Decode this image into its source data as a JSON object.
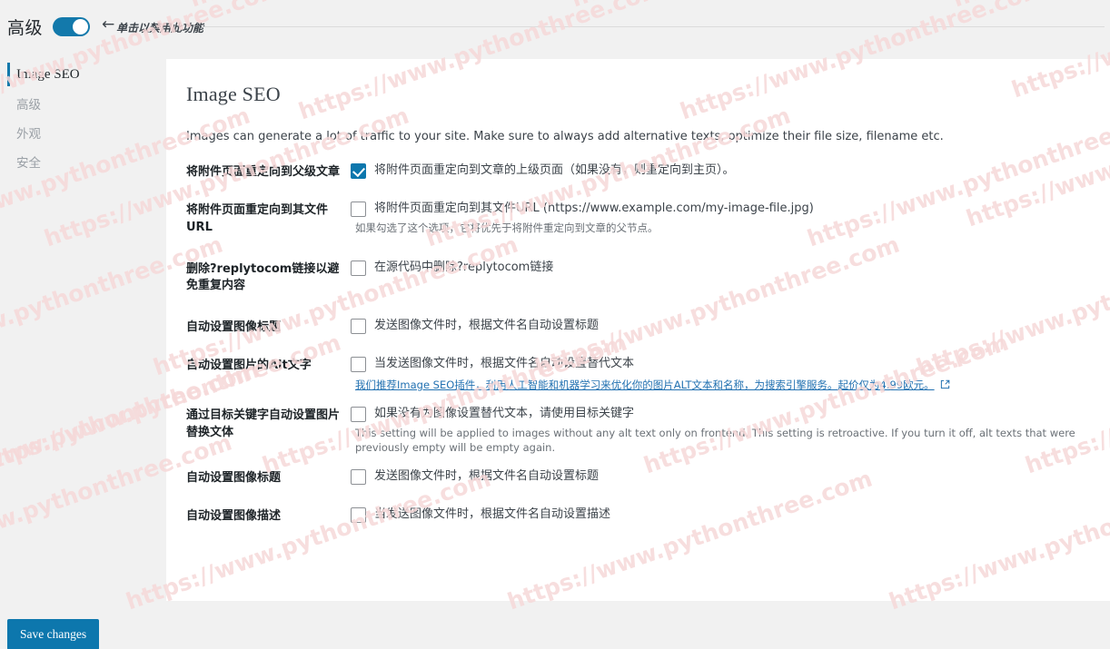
{
  "topbar": {
    "advanced_label": "高级",
    "toggle_on": true,
    "back_arrow_icon": "arrow-left-icon",
    "hint": "单击以禁用此功能"
  },
  "sidebar": {
    "items": [
      {
        "label": "Image SEO",
        "active": true,
        "cjk": false
      },
      {
        "label": "高级",
        "active": false,
        "cjk": true
      },
      {
        "label": "外观",
        "active": false,
        "cjk": true
      },
      {
        "label": "安全",
        "active": false,
        "cjk": true
      }
    ]
  },
  "main": {
    "title": "Image SEO",
    "description": "Images can generate a lot of traffic to your site. Make sure to always add alternative texts, optimize their file size, filename etc.",
    "rows": [
      {
        "label": "将附件页面重定向到父级文章",
        "checked": true,
        "checkbox_label": "将附件页面重定向到文章的上级页面（如果没有，则重定向到主页）。",
        "sub": "",
        "link": "",
        "link_icon": ""
      },
      {
        "label": "将附件页面重定向到其文件URL",
        "checked": false,
        "checkbox_label": "将附件页面重定向到其文件URL (https://www.example.com/my-image-file.jpg)",
        "sub": "如果勾选了这个选项，它将优先于将附件重定向到文章的父节点。",
        "link": "",
        "link_icon": ""
      },
      {
        "label": "删除?replytocom链接以避免重复内容",
        "checked": false,
        "checkbox_label": "在源代码中删除?replytocom链接",
        "sub": "",
        "link": "",
        "link_icon": ""
      },
      {
        "label": "自动设置图像标题",
        "checked": false,
        "checkbox_label": "发送图像文件时，根据文件名自动设置标题",
        "sub": "",
        "link": "",
        "link_icon": ""
      },
      {
        "label": "自动设置图片的Alt文字",
        "checked": false,
        "checkbox_label": "当发送图像文件时，根据文件名自动设置替代文本",
        "sub": "",
        "link": "我们推荐Image SEO插件，利用人工智能和机器学习来优化你的图片ALT文本和名称，为搜索引擎服务。起价仅为4.99欧元。",
        "link_icon": "external-link-icon"
      },
      {
        "label": "通过目标关键字自动设置图片替换文体",
        "checked": false,
        "checkbox_label": "如果没有为图像设置替代文本，请使用目标关键字",
        "sub": "This setting will be applied to images without any alt text only on frontend. This setting is retroactive. If you turn it off, alt texts that were previously empty will be empty again.",
        "link": "",
        "link_icon": ""
      },
      {
        "label": "自动设置图像标题",
        "checked": false,
        "checkbox_label": "发送图像文件时，根据文件名自动设置标题",
        "sub": "",
        "link": "",
        "link_icon": ""
      },
      {
        "label": "自动设置图像描述",
        "checked": false,
        "checkbox_label": "当发送图像文件时，根据文件名自动设置描述",
        "sub": "",
        "link": "",
        "link_icon": ""
      }
    ]
  },
  "footer": {
    "save_label": "Save changes"
  },
  "colors": {
    "accent": "#0d77ad",
    "toggle_on": "#1379ab",
    "link": "#2271b1",
    "page_bg": "#f1f1f1",
    "panel_bg": "#ffffff",
    "watermark": "#f6d9d9"
  },
  "watermark": {
    "text": "https://www.pythonthree.com"
  }
}
